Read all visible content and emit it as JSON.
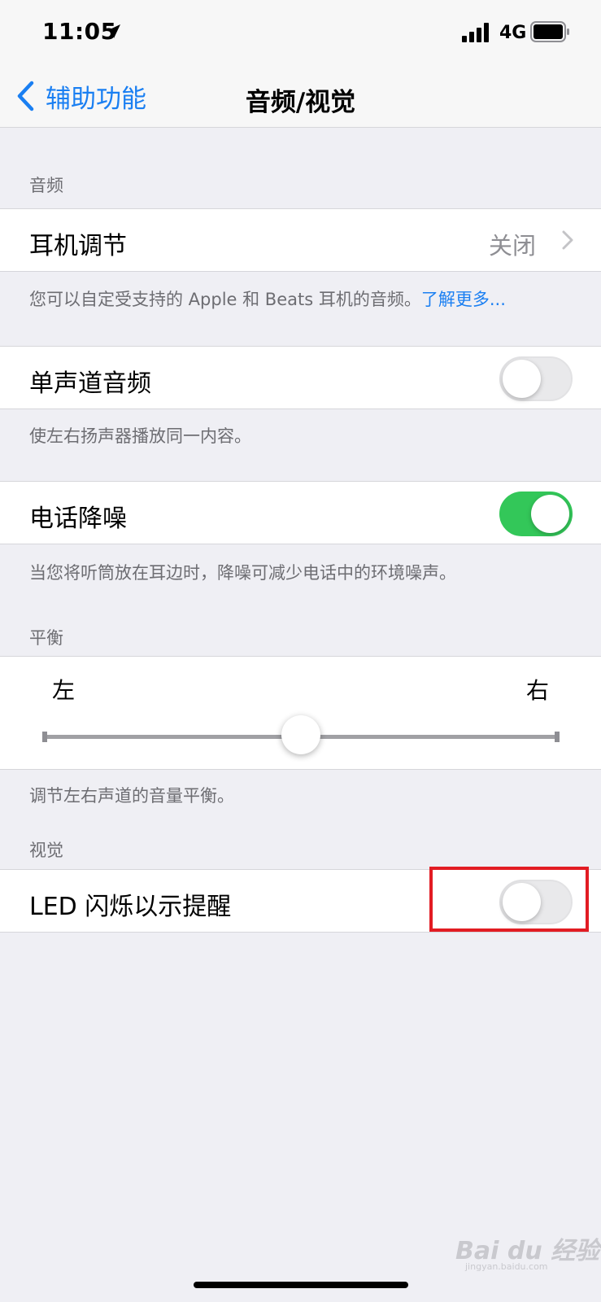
{
  "status": {
    "time": "11:05",
    "network": "4G"
  },
  "nav": {
    "back_label": "辅助功能",
    "title": "音频/视觉"
  },
  "sections": {
    "audio_header": "音频",
    "balance_header": "平衡",
    "visual_header": "视觉"
  },
  "headphone": {
    "label": "耳机调节",
    "value": "关闭",
    "footer": "您可以自定受支持的 Apple 和 Beats 耳机的音频。",
    "footer_link": "了解更多..."
  },
  "mono_audio": {
    "label": "单声道音频",
    "on": false,
    "footer": "使左右扬声器播放同一内容。"
  },
  "phone_noise": {
    "label": "电话降噪",
    "on": true,
    "footer": "当您将听筒放在耳边时，降噪可减少电话中的环境噪声。"
  },
  "balance": {
    "left_label": "左",
    "right_label": "右",
    "value": 0.5,
    "footer": "调节左右声道的音量平衡。"
  },
  "led_flash": {
    "label": "LED 闪烁以示提醒",
    "on": false
  },
  "watermark": {
    "text": "Bai du 经验",
    "sub": "jingyan.baidu.com"
  },
  "colors": {
    "accent": "#1a7ff2",
    "toggle_on": "#33c759",
    "highlight": "#e21c23"
  }
}
